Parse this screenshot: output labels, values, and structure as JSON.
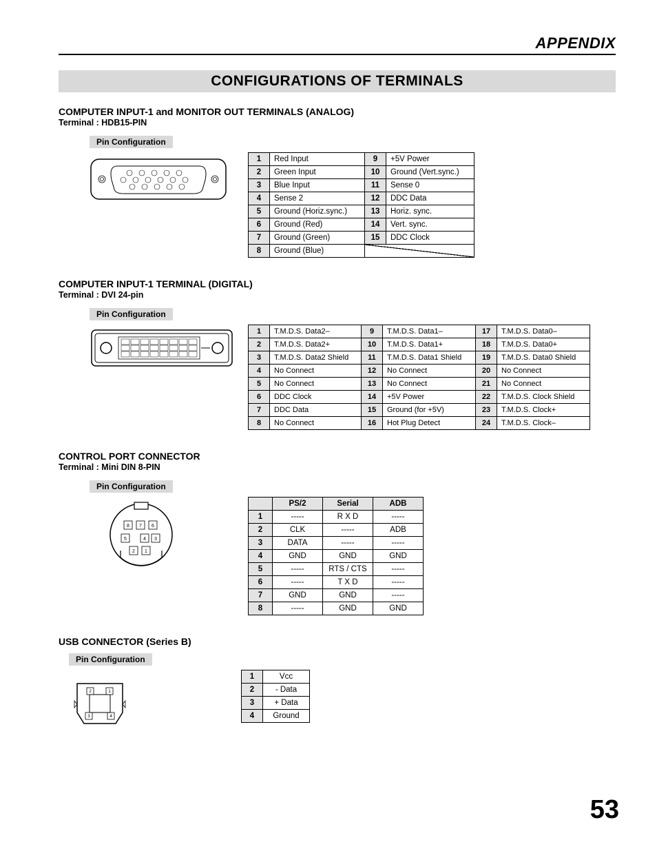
{
  "header": {
    "appendix": "APPENDIX"
  },
  "mainTitle": "CONFIGURATIONS OF TERMINALS",
  "pinConfigLabel": "Pin Configuration",
  "pageNumber": "53",
  "section1": {
    "heading": "COMPUTER INPUT-1 and MONITOR OUT TERMINALS (ANALOG)",
    "sub": "Terminal : HDB15-PIN",
    "rows": [
      {
        "n1": "1",
        "v1": "Red Input",
        "n2": "9",
        "v2": "+5V Power"
      },
      {
        "n1": "2",
        "v1": "Green Input",
        "n2": "10",
        "v2": "Ground (Vert.sync.)"
      },
      {
        "n1": "3",
        "v1": "Blue Input",
        "n2": "11",
        "v2": "Sense 0"
      },
      {
        "n1": "4",
        "v1": "Sense 2",
        "n2": "12",
        "v2": "DDC Data"
      },
      {
        "n1": "5",
        "v1": "Ground (Horiz.sync.)",
        "n2": "13",
        "v2": "Horiz. sync."
      },
      {
        "n1": "6",
        "v1": "Ground (Red)",
        "n2": "14",
        "v2": "Vert. sync."
      },
      {
        "n1": "7",
        "v1": "Ground (Green)",
        "n2": "15",
        "v2": "DDC Clock"
      },
      {
        "n1": "8",
        "v1": "Ground (Blue)",
        "n2": "",
        "v2": ""
      }
    ]
  },
  "section2": {
    "heading": "COMPUTER INPUT-1 TERMINAL (DIGITAL)",
    "sub": "Terminal : DVI 24-pin",
    "rows": [
      {
        "n1": "1",
        "v1": "T.M.D.S. Data2–",
        "n2": "9",
        "v2": "T.M.D.S. Data1–",
        "n3": "17",
        "v3": "T.M.D.S. Data0–"
      },
      {
        "n1": "2",
        "v1": "T.M.D.S. Data2+",
        "n2": "10",
        "v2": "T.M.D.S. Data1+",
        "n3": "18",
        "v3": "T.M.D.S. Data0+"
      },
      {
        "n1": "3",
        "v1": "T.M.D.S. Data2 Shield",
        "n2": "11",
        "v2": "T.M.D.S. Data1 Shield",
        "n3": "19",
        "v3": "T.M.D.S. Data0 Shield"
      },
      {
        "n1": "4",
        "v1": "No Connect",
        "n2": "12",
        "v2": "No Connect",
        "n3": "20",
        "v3": "No Connect"
      },
      {
        "n1": "5",
        "v1": "No Connect",
        "n2": "13",
        "v2": "No Connect",
        "n3": "21",
        "v3": "No Connect"
      },
      {
        "n1": "6",
        "v1": "DDC Clock",
        "n2": "14",
        "v2": "+5V Power",
        "n3": "22",
        "v3": "T.M.D.S. Clock Shield"
      },
      {
        "n1": "7",
        "v1": "DDC Data",
        "n2": "15",
        "v2": "Ground (for +5V)",
        "n3": "23",
        "v3": "T.M.D.S. Clock+"
      },
      {
        "n1": "8",
        "v1": "No Connect",
        "n2": "16",
        "v2": "Hot Plug Detect",
        "n3": "24",
        "v3": "T.M.D.S. Clock–"
      }
    ]
  },
  "section3": {
    "heading": "CONTROL PORT CONNECTOR",
    "sub": "Terminal : Mini DIN 8-PIN",
    "headers": {
      "h1": "PS/2",
      "h2": "Serial",
      "h3": "ADB"
    },
    "rows": [
      {
        "n": "1",
        "a": "-----",
        "b": "R X D",
        "c": "-----"
      },
      {
        "n": "2",
        "a": "CLK",
        "b": "-----",
        "c": "ADB"
      },
      {
        "n": "3",
        "a": "DATA",
        "b": "-----",
        "c": "-----"
      },
      {
        "n": "4",
        "a": "GND",
        "b": "GND",
        "c": "GND"
      },
      {
        "n": "5",
        "a": "-----",
        "b": "RTS / CTS",
        "c": "-----"
      },
      {
        "n": "6",
        "a": "-----",
        "b": "T X D",
        "c": "-----"
      },
      {
        "n": "7",
        "a": "GND",
        "b": "GND",
        "c": "-----"
      },
      {
        "n": "8",
        "a": "-----",
        "b": "GND",
        "c": "GND"
      }
    ]
  },
  "section4": {
    "heading": "USB CONNECTOR (Series B)",
    "rows": [
      {
        "n": "1",
        "v": "Vcc"
      },
      {
        "n": "2",
        "v": "- Data"
      },
      {
        "n": "3",
        "v": "+ Data"
      },
      {
        "n": "4",
        "v": "Ground"
      }
    ]
  }
}
